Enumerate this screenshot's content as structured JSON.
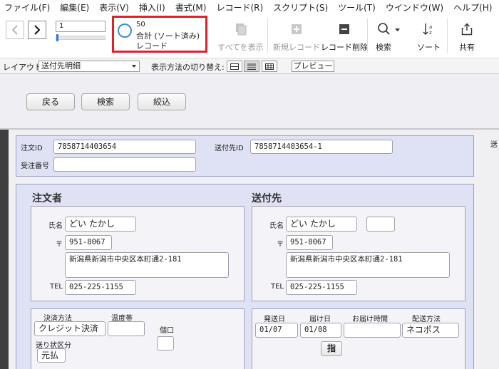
{
  "menu": [
    "ファイル(F)",
    "編集(E)",
    "表示(V)",
    "挿入(I)",
    "書式(M)",
    "レコード(R)",
    "スクリプト(S)",
    "ツール(T)",
    "ウインドウ(W)",
    "ヘルプ(H)"
  ],
  "toolbar": {
    "record_number": "1",
    "record_count": "50",
    "total_label": "合計 (ソート済み)",
    "record_label": "レコード",
    "show_all": "すべてを表示",
    "new_record": "新規レコード",
    "delete_record": "レコード削除",
    "find": "検索",
    "sort": "ソート",
    "share": "共有"
  },
  "layout_bar": {
    "layout_label": "レイアウト:",
    "layout_value": "送付先明細",
    "view_label": "表示方法の切り替え:",
    "preview": "プレビュー"
  },
  "header_buttons": {
    "back": "戻る",
    "search": "検索",
    "filter": "絞込"
  },
  "ids": {
    "order_id_label": "注文ID",
    "order_id": "7858714403654",
    "ship_id_label": "送付先ID",
    "ship_id": "7858714403654-1",
    "order_no_label": "受注番号",
    "order_no": "",
    "cut_label": "送"
  },
  "orderer": {
    "heading": "注文者",
    "name_label": "氏名",
    "name": "どい たかし",
    "zip_label": "〒",
    "zip": "951-8067",
    "address": "新潟県新潟市中央区本町通2-181",
    "tel_label": "TEL",
    "tel": "025-225-1155"
  },
  "recipient": {
    "heading": "送付先",
    "name_label": "氏名",
    "name": "どい たかし",
    "honorific": "",
    "zip_label": "〒",
    "zip": "951-8067",
    "address": "新潟県新潟市中央区本町通2-181",
    "tel_label": "TEL",
    "tel": "025-225-1155"
  },
  "payment": {
    "method_label": "決済方法",
    "method": "クレジット決済",
    "temp_label": "温度帯",
    "temp": "",
    "qty_label": "個口",
    "qty": "",
    "invoice_label": "送り状区分",
    "invoice": "元払"
  },
  "shipping": {
    "ship_date_label": "発送日",
    "ship_date": "01/07",
    "arrival_label": "届け日",
    "arrival": "01/08",
    "time_label": "お届け時間",
    "time": "",
    "method_label": "配送方法",
    "method": "ネコポス",
    "specify_button": "指"
  }
}
